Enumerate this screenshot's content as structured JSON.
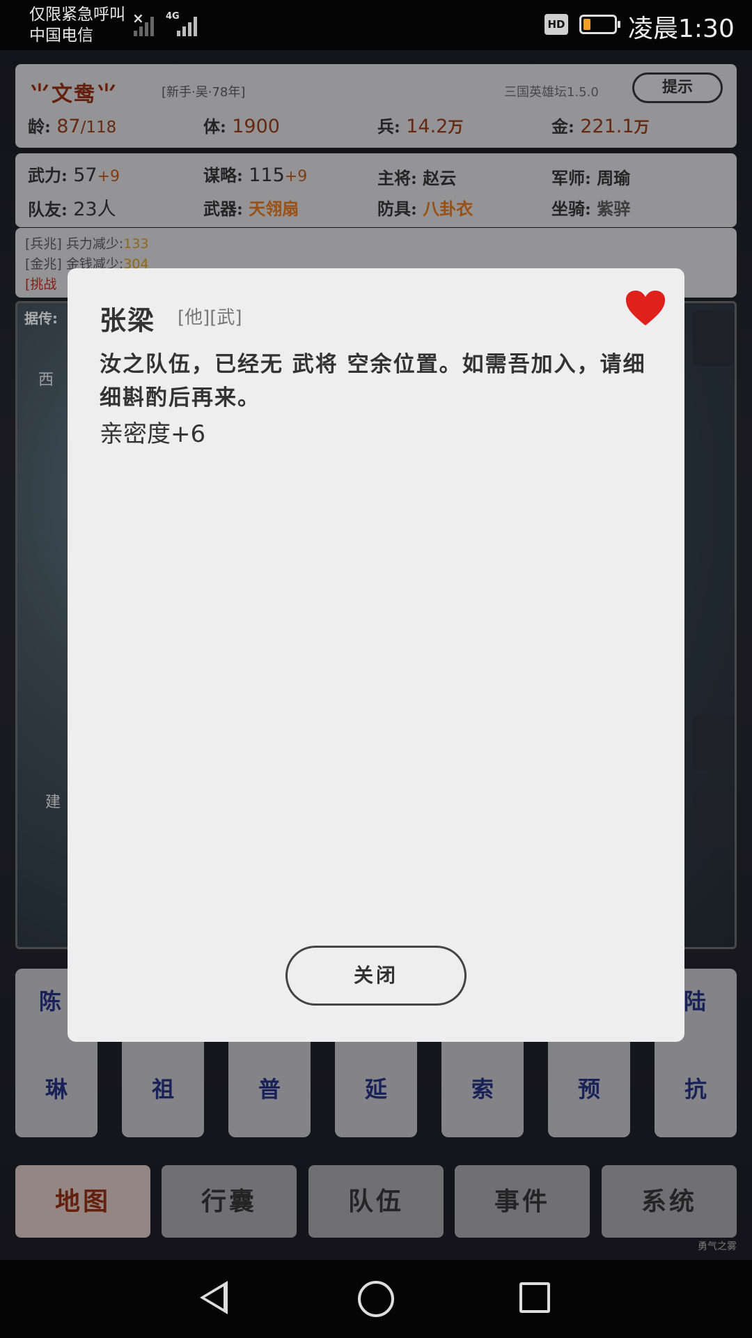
{
  "status_bar": {
    "carrier_line1": "仅限紧急呼叫",
    "carrier_line2": "中国电信",
    "network": "4G",
    "hd": "HD",
    "time": "凌晨1:30",
    "battery_level": 0.2
  },
  "header": {
    "name": "⺌文鸯⺌",
    "subtitle": "[新手·吴·78年]",
    "version": "三国英雄坛1.5.0",
    "hint_button": "提示"
  },
  "stats_row1": [
    {
      "key": "龄",
      "value": "87",
      "extra": "/118"
    },
    {
      "key": "体",
      "value": "1900",
      "extra": ""
    },
    {
      "key": "兵",
      "value": "14.2",
      "extra": "万"
    },
    {
      "key": "金",
      "value": "221.1",
      "extra": "万"
    }
  ],
  "stats_row2": [
    {
      "key": "武力",
      "value": "57",
      "extra": "+9"
    },
    {
      "key": "谋略",
      "value": "115",
      "extra": "+9"
    },
    {
      "key": "主将",
      "value": "赵云"
    },
    {
      "key": "军师",
      "value": "周瑜"
    }
  ],
  "stats_row3": [
    {
      "key": "队友",
      "value": "23人"
    },
    {
      "key": "武器",
      "value": "天翎扇"
    },
    {
      "key": "防具",
      "value": "八卦衣"
    },
    {
      "key": "坐骑",
      "value": "紫骍"
    }
  ],
  "logs": [
    {
      "tag": "[兵兆]",
      "text": "兵力减少:",
      "value": "133"
    },
    {
      "tag": "[金兆]",
      "text": "金钱减少:",
      "value": "304"
    },
    {
      "tag": "[挑战",
      "text": "",
      "value": ""
    }
  ],
  "map": {
    "label": "据传:",
    "side_labels": [
      "西",
      "建"
    ]
  },
  "tiles_top": [
    "陈",
    "陆"
  ],
  "tiles": [
    "琳",
    "祖",
    "普",
    "延",
    "索",
    "预",
    "抗"
  ],
  "bottom_nav": [
    "地图",
    "行囊",
    "队伍",
    "事件",
    "系统"
  ],
  "corner_mark": "勇气之雾",
  "dialog": {
    "name": "张梁",
    "tags": "[他][武]",
    "message": "汝之队伍，已经无 武将 空余位置。如需吾加入，请细细斟酌后再来。",
    "extra": "亲密度+6",
    "close_button": "关闭"
  },
  "colors": {
    "accent_red": "#8b2c12",
    "heart": "#e0201a",
    "tile_text": "#23307a"
  }
}
